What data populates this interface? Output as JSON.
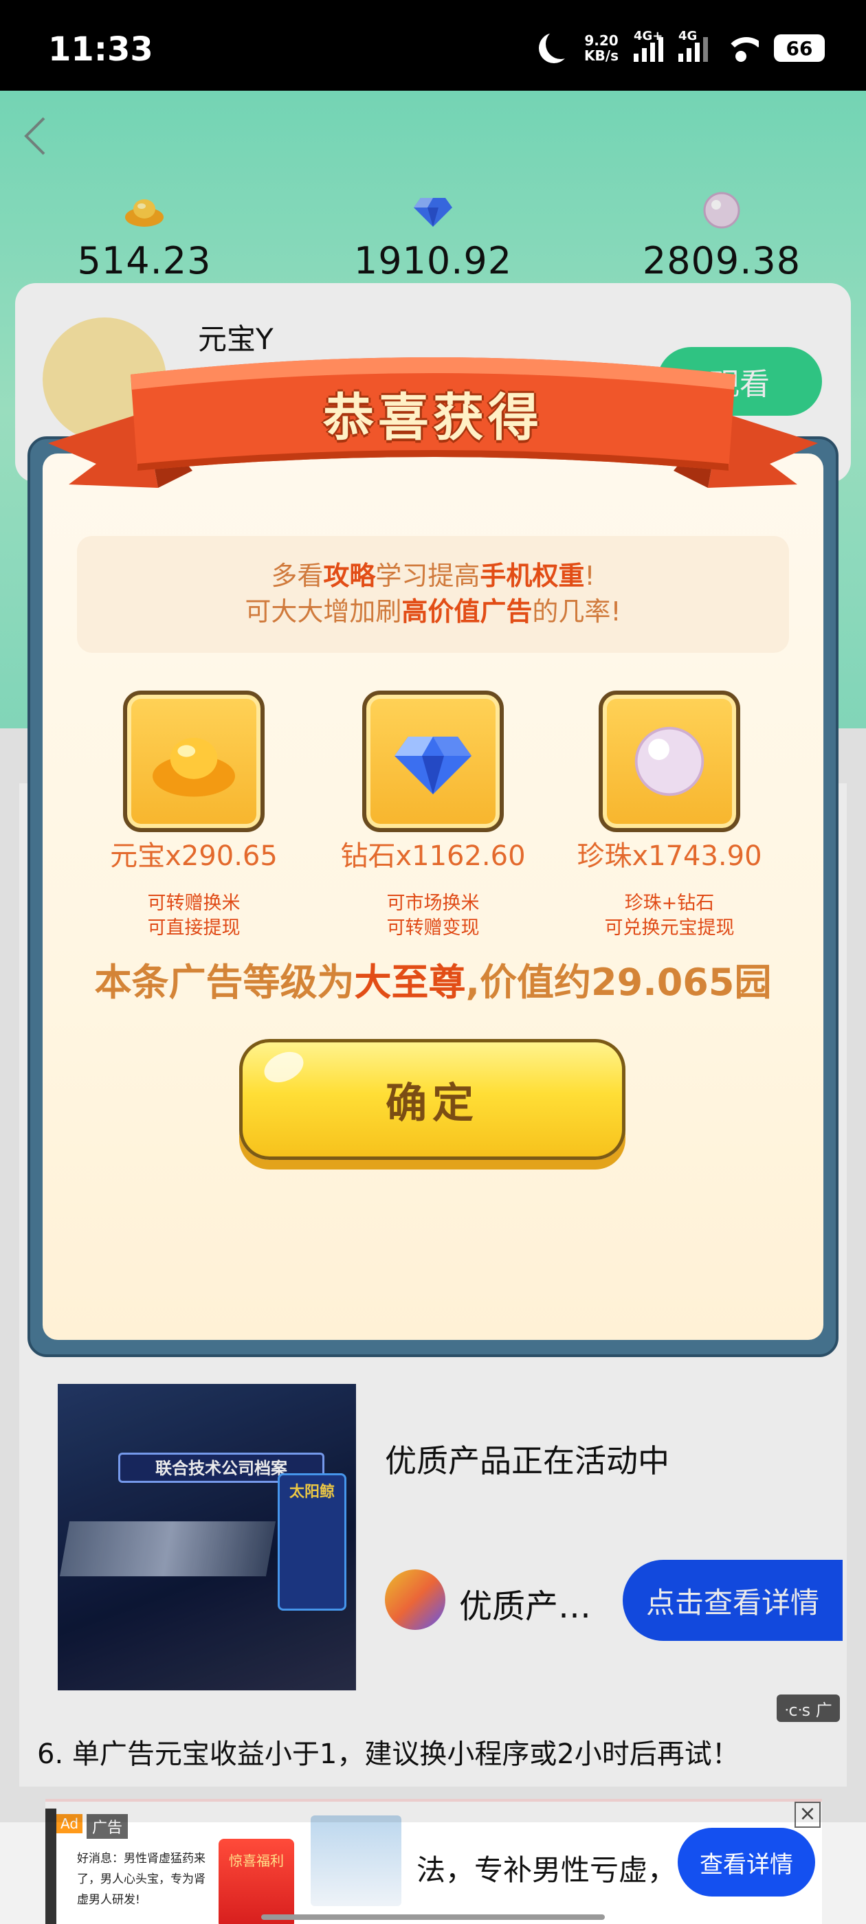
{
  "status_bar": {
    "time": "11:33",
    "net_speed_value": "9.20",
    "net_speed_unit": "KB/s",
    "sim1_label": "4G+",
    "sim2_label": "4G",
    "battery": "66"
  },
  "balances": [
    {
      "icon": "gold-ingot-icon",
      "value": "514.23"
    },
    {
      "icon": "diamond-icon",
      "value": "1910.92"
    },
    {
      "icon": "pearl-icon",
      "value": "2809.38"
    }
  ],
  "card": {
    "name": "元宝Y",
    "watch_label": "观看"
  },
  "modal": {
    "title": "恭喜获得",
    "tip_line1": [
      "多看",
      "攻略",
      "学习提高",
      "手机权重",
      "!"
    ],
    "tip_line2": [
      "可大大增加刷",
      "高价值广告",
      "的几率!"
    ],
    "rewards": [
      {
        "icon": "gold-ingot-icon",
        "amount": "元宝x290.65",
        "desc1": "可转赠换米",
        "desc2": "可直接提现"
      },
      {
        "icon": "diamond-icon",
        "amount": "钻石x1162.60",
        "desc1": "可市场换米",
        "desc2": "可转赠变现"
      },
      {
        "icon": "pearl-icon",
        "amount": "珍珠x1743.90",
        "desc1": "珍珠+钻石",
        "desc2": "可兑换元宝提现"
      }
    ],
    "grade_prefix": "本条广告等级为",
    "grade_level": "大至尊",
    "grade_suffix": ",价值约29.065园",
    "confirm_label": "确定"
  },
  "ad": {
    "title": "优质产品正在活动中",
    "brand": "优质产…",
    "cta": "点击查看详情",
    "corner_mark": "ᐧcᐧs 广",
    "image_text": "联合技术公司档案",
    "image_badge": "太阳鲸"
  },
  "note": "6. 单广告元宝收益小于1，建议换小程序或2小时后再试！",
  "banner": {
    "ad_tag": "Ad",
    "tag": "广告",
    "left_text": "好消息：男性肾虚猛药来了，男人心头宝，专为肾虚男人研发!",
    "red_label": "惊喜福利",
    "copy": "法，专补男性亏虚，",
    "cta": "查看详情",
    "close": "×"
  },
  "colors": {
    "accent_green": "#33d48e",
    "highlight_red": "#e24d16",
    "tip_orange": "#d07a3c",
    "cta_blue": "#1450f0",
    "ribbon_red": "#f0562a"
  }
}
